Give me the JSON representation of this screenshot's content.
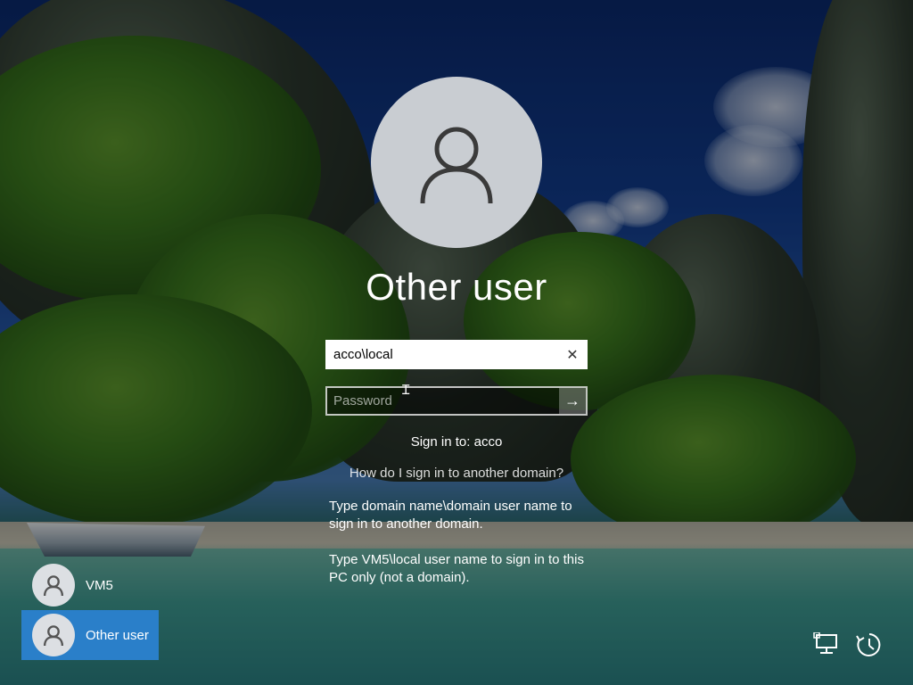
{
  "login": {
    "title": "Other user",
    "username_value": "acco\\local",
    "password_placeholder": "Password",
    "sign_in_to": "Sign in to: acco",
    "help_link": "How do I sign in to another domain?",
    "hint_domain": "Type domain name\\domain user name to sign in to another domain.",
    "hint_local": "Type VM5\\local user name to sign in to this PC only (not a domain).",
    "clear_glyph": "✕",
    "submit_glyph": "→"
  },
  "users": [
    {
      "label": "VM5",
      "selected": false
    },
    {
      "label": "Other user",
      "selected": true
    }
  ],
  "corner_icons": [
    "network-icon",
    "accessibility-icon"
  ],
  "colors": {
    "selected_tile": "#2a7fc9",
    "avatar_bg": "#c9cdd2"
  }
}
